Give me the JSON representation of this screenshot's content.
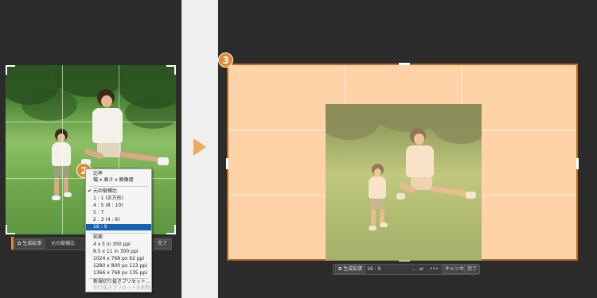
{
  "left": {
    "menu": {
      "header_items": [
        "比率",
        "幅 x 高さ x 解像度"
      ],
      "ratio_items": [
        "元の縦横比",
        "1 : 1 (正方形)",
        "4 : 5 (8 : 10)",
        "5 : 7",
        "2 : 3 (4 : 6)",
        "16 : 9"
      ],
      "checked_item": "元の縦横比",
      "selected_item": "16 : 9",
      "preset_header": "前面",
      "preset_items": [
        "4 x 5 in 300 ppi",
        "8.5 x 11 in 300 ppi",
        "1024 x 768 px 92 ppi",
        "1280 x 800 px 113 ppi",
        "1366 x 768 px 135 ppi"
      ],
      "footer_items": [
        "新規切り抜きプリセット...",
        "切り抜きプリセットを削除..."
      ]
    },
    "toolbar": {
      "generative_expand": "生成拡張",
      "ratio_value": "元の縦横比",
      "done": "完了"
    },
    "badge": "2"
  },
  "right": {
    "badge": "3",
    "toolbar": {
      "generative_expand": "生成拡張",
      "ratio_value": "16 : 9",
      "cancel": "キャンセル",
      "done": "完了"
    }
  },
  "colors": {
    "accent": "#e38a2a",
    "selection": "#1463b4",
    "expand_area": "#ffd2a8",
    "frame": "#b76d23"
  },
  "icons": [
    "generative-expand-icon",
    "swap-icon",
    "more-icon",
    "play-arrow-icon",
    "checkmark-icon"
  ]
}
